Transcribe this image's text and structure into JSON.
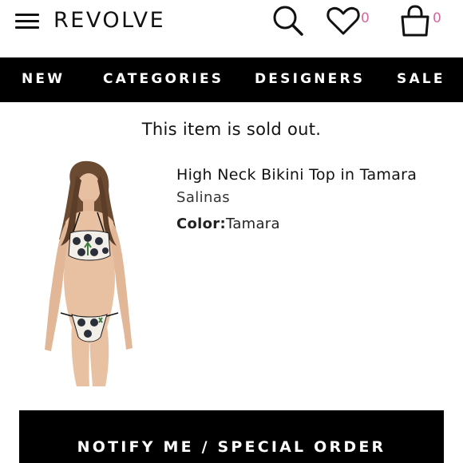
{
  "header": {
    "logo": "REVOLVE",
    "wishlist_count": "0",
    "bag_count": "0",
    "icons": [
      "menu-icon",
      "search-icon",
      "heart-icon",
      "bag-icon"
    ]
  },
  "nav": {
    "items": [
      "NEW",
      "CATEGORIES",
      "DESIGNERS",
      "SALE"
    ]
  },
  "status": {
    "message": "This item is sold out."
  },
  "product": {
    "title": "High Neck Bikini Top in Tamara",
    "brand": "Salinas",
    "color_label": "Color:",
    "color_value": "Tamara"
  },
  "cta": {
    "label": "NOTIFY ME / SPECIAL ORDER"
  },
  "colors": {
    "accent_badge": "#d6679c",
    "nav_background": "#000000",
    "text": "#111111"
  }
}
